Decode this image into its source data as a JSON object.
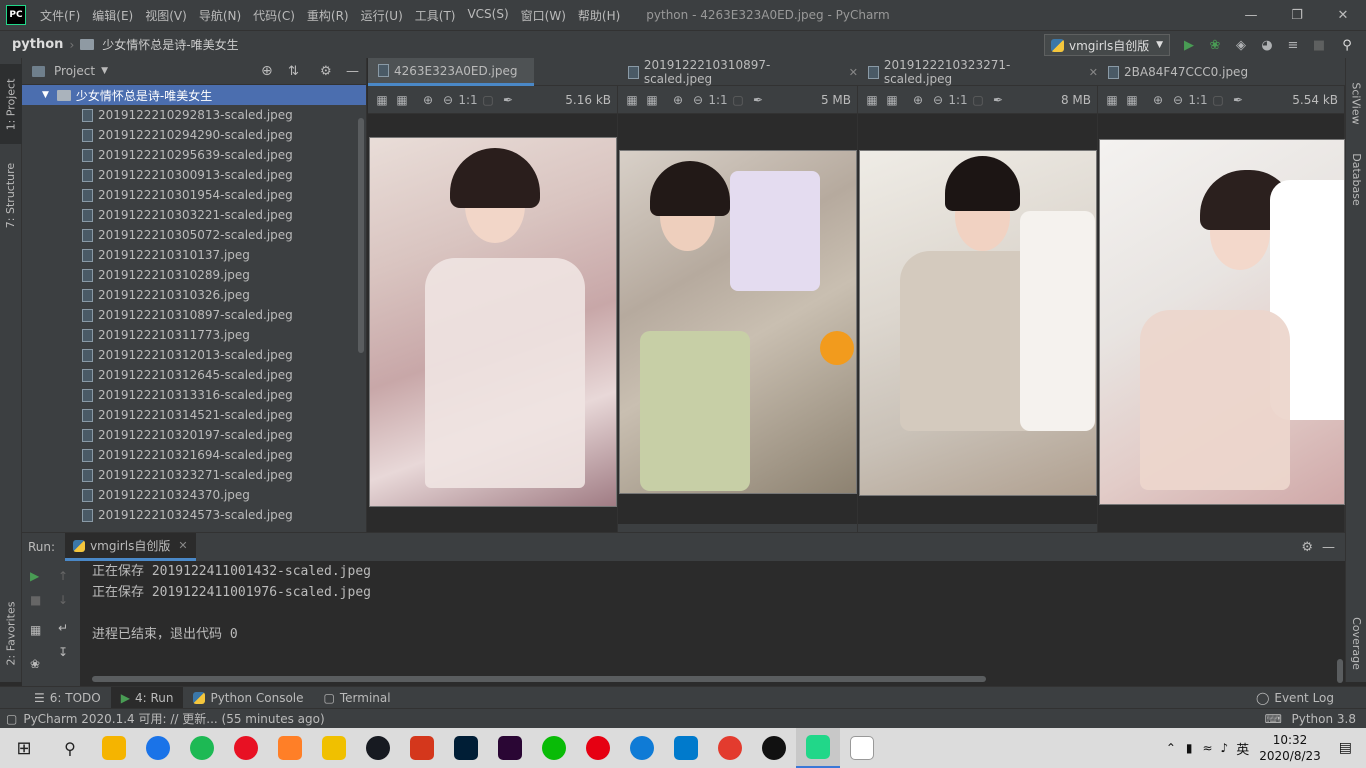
{
  "titlebar": {
    "logo": "PC",
    "menu": [
      "文件(F)",
      "编辑(E)",
      "视图(V)",
      "导航(N)",
      "代码(C)",
      "重构(R)",
      "运行(U)",
      "工具(T)",
      "VCS(S)",
      "窗口(W)",
      "帮助(H)"
    ],
    "title": "python - 4263E323A0ED.jpeg - PyCharm"
  },
  "navbar": {
    "root": "python",
    "folder": "少女情怀总是诗-唯美女生",
    "run_config": "vmgirls自创版"
  },
  "left_strip": {
    "project": "1: Project",
    "structure": "7: Structure",
    "favorites": "2: Favorites"
  },
  "right_strip": {
    "sciview": "SciView",
    "database": "Database",
    "coverage": "Coverage"
  },
  "project": {
    "title": "Project",
    "root_folder": "少女情怀总是诗-唯美女生",
    "files": [
      "2019122210292813-scaled.jpeg",
      "2019122210294290-scaled.jpeg",
      "2019122210295639-scaled.jpeg",
      "2019122210300913-scaled.jpeg",
      "2019122210301954-scaled.jpeg",
      "2019122210303221-scaled.jpeg",
      "2019122210305072-scaled.jpeg",
      "2019122210310137.jpeg",
      "2019122210310289.jpeg",
      "2019122210310326.jpeg",
      "2019122210310897-scaled.jpeg",
      "2019122210311773.jpeg",
      "2019122210312013-scaled.jpeg",
      "2019122210312645-scaled.jpeg",
      "2019122210313316-scaled.jpeg",
      "2019122210314521-scaled.jpeg",
      "2019122210320197-scaled.jpeg",
      "2019122210321694-scaled.jpeg",
      "2019122210323271-scaled.jpeg",
      "2019122210324370.jpeg",
      "2019122210324573-scaled.jpeg"
    ]
  },
  "editor": {
    "tabs": [
      {
        "label": "4263E323A0ED.jpeg",
        "size": "5.16 kB"
      },
      {
        "label": "2019122210310897-scaled.jpeg",
        "size": "5 MB"
      },
      {
        "label": "2019122210323271-scaled.jpeg",
        "size": "8 MB"
      },
      {
        "label": "2BA84F47CCC0.jpeg",
        "size": "5.54 kB"
      }
    ],
    "zoom_label": "1:1"
  },
  "run": {
    "label": "Run:",
    "config": "vmgirls自创版",
    "lines": [
      "正在保存 2019122411001432-scaled.jpeg",
      "正在保存 2019122411001976-scaled.jpeg",
      "",
      "进程已结束，退出代码 0"
    ]
  },
  "bottom_tabs": {
    "todo": "6: TODO",
    "run": "4: Run",
    "python_console": "Python Console",
    "terminal": "Terminal",
    "event_log": "Event Log"
  },
  "status": {
    "message": "PyCharm 2020.1.4 可用: // 更新... (55 minutes ago)",
    "interpreter": "Python 3.8"
  },
  "taskbar": {
    "time": "10:32",
    "date": "2020/8/23",
    "ime": "英",
    "icon_colors": [
      "#f5b400",
      "#1a73e8",
      "#1db954",
      "#e81123",
      "#ff7f27",
      "#f0c000",
      "#171a21",
      "#d4371c",
      "#001e36",
      "#2a0634",
      "#09bb07",
      "#e60012",
      "#0f7bd6",
      "#007acc",
      "#e33b2e",
      "#111111",
      "#21d789",
      "#ffffff"
    ]
  }
}
